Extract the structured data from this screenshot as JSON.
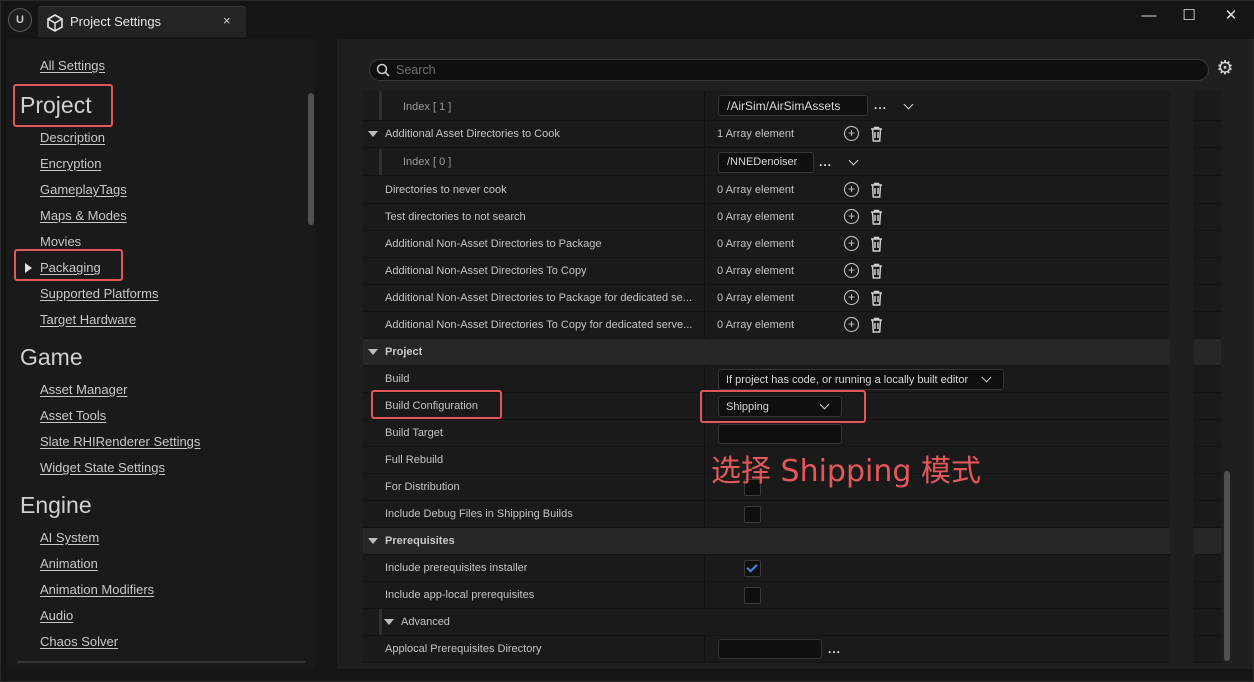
{
  "window": {
    "tab_title": "Project Settings",
    "tab_close": "×",
    "logo_text": "U",
    "minimize": "—",
    "maximize": "☐",
    "close": "✕"
  },
  "sidebar": {
    "all_settings": "All Settings",
    "sections": [
      {
        "title": "Project",
        "items": [
          "Description",
          "Encryption",
          "GameplayTags",
          "Maps & Modes",
          "Movies",
          "Packaging",
          "Supported Platforms",
          "Target Hardware"
        ]
      },
      {
        "title": "Game",
        "items": [
          "Asset Manager",
          "Asset Tools",
          "Slate RHIRenderer Settings",
          "Widget State Settings"
        ]
      },
      {
        "title": "Engine",
        "items": [
          "AI System",
          "Animation",
          "Animation Modifiers",
          "Audio",
          "Chaos Solver"
        ]
      }
    ],
    "selected_item": "Packaging"
  },
  "search": {
    "placeholder": "Search"
  },
  "properties": {
    "index1_label": "Index [ 1 ]",
    "index1_value": "/AirSim/AirSimAssets",
    "cook_dirs_label": "Additional Asset Directories to Cook",
    "cook_dirs_value": "1 Array element",
    "index0_label": "Index [ 0 ]",
    "index0_value": "/NNEDenoiser",
    "never_cook_label": "Directories to never cook",
    "never_cook_value": "0 Array element",
    "test_dirs_label": "Test directories to not search",
    "test_dirs_value": "0 Array element",
    "nonasset_pkg_label": "Additional Non-Asset Directories to Package",
    "nonasset_pkg_value": "0 Array element",
    "nonasset_copy_label": "Additional Non-Asset Directories To Copy",
    "nonasset_copy_value": "0 Array element",
    "nonasset_pkg_ded_label": "Additional Non-Asset Directories to Package for dedicated se...",
    "nonasset_pkg_ded_value": "0 Array element",
    "nonasset_copy_ded_label": "Additional Non-Asset Directories To Copy for dedicated serve...",
    "nonasset_copy_ded_value": "0 Array element",
    "project_section": "Project",
    "build_label": "Build",
    "build_value": "If project has code, or running a locally built editor",
    "build_config_label": "Build Configuration",
    "build_config_value": "Shipping",
    "build_target_label": "Build Target",
    "full_rebuild_label": "Full Rebuild",
    "for_distribution_label": "For Distribution",
    "include_debug_label": "Include Debug Files in Shipping Builds",
    "prereq_section": "Prerequisites",
    "prereq_installer_label": "Include prerequisites installer",
    "prereq_installer_checked": true,
    "applocal_label": "Include app-local prerequisites",
    "advanced_label": "Advanced",
    "applocal_dir_label": "Applocal Prerequisites Directory",
    "ellipsis": "..."
  },
  "annotation": "选择 Shipping 模式",
  "colors": {
    "highlight": "#e3575a",
    "check": "#3d8ee8"
  }
}
